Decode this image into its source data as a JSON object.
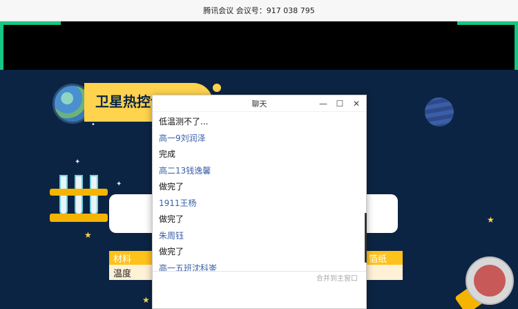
{
  "window_title": "腾讯会议 会议号：917 038 795",
  "slide": {
    "banner_title": "卫星热控设",
    "table": {
      "header_left": "材料",
      "header_right": "箔纸",
      "row_left": "温度"
    }
  },
  "chat": {
    "title": "聊天",
    "minimize_label": "—",
    "maximize_label": "☐",
    "close_label": "✕",
    "messages": [
      {
        "kind": "text",
        "value": "低温测不了..."
      },
      {
        "kind": "sender",
        "value": "高一9刘润泽"
      },
      {
        "kind": "text",
        "value": "完成"
      },
      {
        "kind": "sender",
        "value": "高二13钱逸馨"
      },
      {
        "kind": "text",
        "value": "做完了"
      },
      {
        "kind": "sender",
        "value": "1911王杨"
      },
      {
        "kind": "text",
        "value": "做完了"
      },
      {
        "kind": "sender",
        "value": "朱周钰"
      },
      {
        "kind": "text",
        "value": "做完了"
      },
      {
        "kind": "sender",
        "value": "高一五班沈科崟"
      }
    ],
    "merge_label": "合并到主窗口"
  },
  "colors": {
    "accent_green": "#16c784",
    "slide_bg": "#0c2443",
    "banner_yellow": "#ffd34d",
    "sender_blue": "#3a5fa8"
  }
}
